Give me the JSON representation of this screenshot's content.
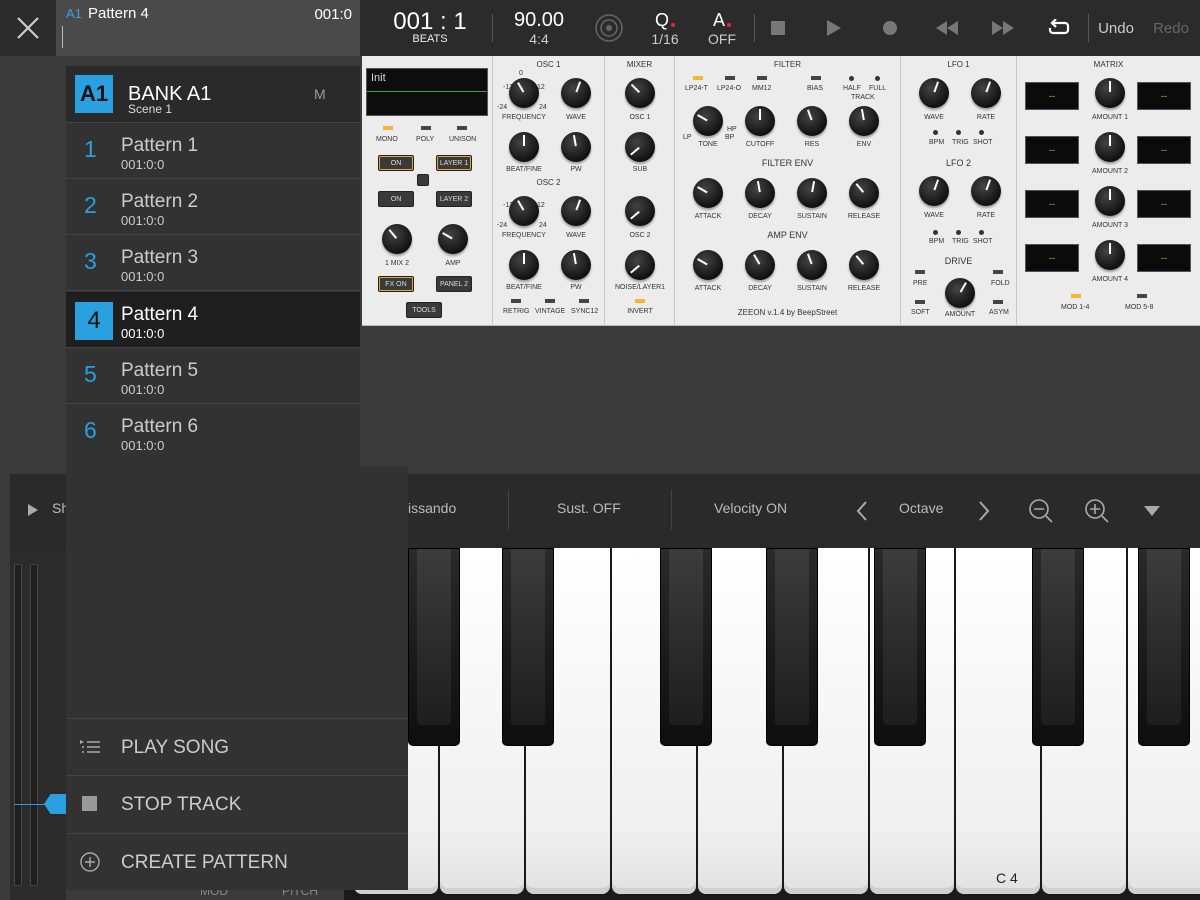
{
  "header": {
    "pattern_code": "A1",
    "pattern_name": "Pattern 4",
    "pattern_position": "001:0",
    "position": "001 : 1",
    "position_unit": "BEATS",
    "tempo": "90.00",
    "time_signature": "4:4",
    "quantize_label": "Q",
    "quantize_value": "1/16",
    "automation_label": "A",
    "automation_value": "OFF",
    "undo": "Undo",
    "redo": "Redo"
  },
  "menu": {
    "bank_badge": "A1",
    "bank_name": "BANK A1",
    "scene": "Scene 1",
    "bank_flag": "M",
    "patterns": [
      {
        "num": "1",
        "name": "Pattern 1",
        "pos": "001:0:0"
      },
      {
        "num": "2",
        "name": "Pattern 2",
        "pos": "001:0:0"
      },
      {
        "num": "3",
        "name": "Pattern 3",
        "pos": "001:0:0"
      },
      {
        "num": "4",
        "name": "Pattern 4",
        "pos": "001:0:0"
      },
      {
        "num": "5",
        "name": "Pattern 5",
        "pos": "001:0:0"
      },
      {
        "num": "6",
        "name": "Pattern 6",
        "pos": "001:0:0"
      }
    ],
    "actions": {
      "play_song": "PLAY SONG",
      "stop_track": "STOP TRACK",
      "create_pattern": "CREATE PATTERN"
    }
  },
  "synth": {
    "preset": "Init",
    "sections": {
      "osc1": "OSC 1",
      "osc2": "OSC 2",
      "mixer": "MIXER",
      "filter": "FILTER",
      "filter_env": "FILTER ENV",
      "amp_env": "AMP ENV",
      "lfo1": "LFO 1",
      "lfo2": "LFO 2",
      "drive": "DRIVE",
      "matrix": "MATRIX"
    },
    "voice": [
      "MONO",
      "POLY",
      "UNISON"
    ],
    "buttons": {
      "on1": "ON",
      "layer1": "LAYER 1",
      "on2": "ON",
      "layer2": "LAYER 2",
      "fx_on": "FX ON",
      "panel2": "PANEL 2",
      "tools": "TOOLS"
    },
    "mix_knobs": [
      "1 MIX 2",
      "AMP"
    ],
    "osc1_knobs": [
      "FREQUENCY",
      "WAVE",
      "BEAT/FINE",
      "PW"
    ],
    "osc2_knobs": [
      "FREQUENCY",
      "WAVE",
      "BEAT/FINE",
      "PW"
    ],
    "osc_scale": {
      "lo": "-24",
      "hi": "24",
      "min": "-12",
      "max": "12",
      "zero": "0"
    },
    "osc_flags": [
      "RETRIG",
      "VINTAGE",
      "SYNC12"
    ],
    "mixer_knobs": [
      "OSC 1",
      "SUB",
      "OSC 2",
      "NOISE/LAYER1"
    ],
    "mixer_flag": "INVERT",
    "filter_modes": [
      "LP24-T",
      "LP24-O",
      "MM12",
      "BIAS",
      "HALF",
      "FULL"
    ],
    "filter_track": "TRACK",
    "filter_knobs": [
      "TONE",
      "CUTOFF",
      "RES",
      "ENV"
    ],
    "tone_marks": [
      "LP",
      "HP",
      "BP"
    ],
    "env_knobs": [
      "ATTACK",
      "DECAY",
      "SUSTAIN",
      "RELEASE"
    ],
    "lfo_knobs": [
      "WAVE",
      "RATE"
    ],
    "lfo_flags": [
      "BPM",
      "TRIG",
      "SHOT"
    ],
    "drive_labels": [
      "PRE",
      "FOLD",
      "SOFT",
      "ASYM",
      "AMOUNT"
    ],
    "matrix_amounts": [
      "AMOUNT 1",
      "AMOUNT 2",
      "AMOUNT 3",
      "AMOUNT 4"
    ],
    "matrix_lcd": "--",
    "matrix_mods": [
      "MOD 1-4",
      "MOD 5-8"
    ],
    "footer": "ZEEON v.1.4 by BeepStreet"
  },
  "keyboard_controls": {
    "show": "Sh",
    "glissando": "issando",
    "sustain": "Sust. OFF",
    "velocity": "Velocity ON",
    "octave": "Octave",
    "key_label": "C 4",
    "mod_label": "MOD",
    "pitch_label": "PITCH"
  },
  "colors": {
    "accent": "#2aa0e0",
    "led": "#f5b731",
    "panel": "#ececec"
  }
}
